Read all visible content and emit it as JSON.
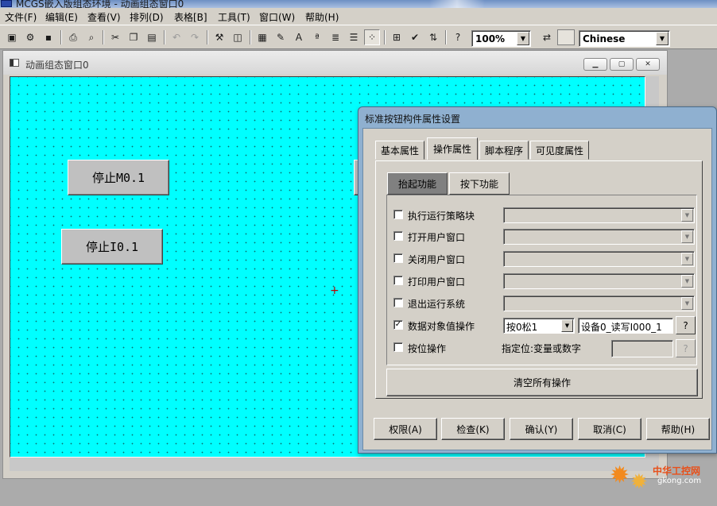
{
  "app": {
    "title": "MCGS嵌入版组态环境 - 动画组态窗口0"
  },
  "menubar": {
    "items": [
      "文件(F)",
      "编辑(E)",
      "查看(V)",
      "排列(D)",
      "表格[B]",
      "工具(T)",
      "窗口(W)",
      "帮助(H)"
    ]
  },
  "toolbar": {
    "zoom_value": "100%",
    "language_value": "Chinese",
    "icons": [
      "new-window-icon",
      "run-icon",
      "save-icon",
      "print-icon",
      "print-preview-icon",
      "cut-icon",
      "copy-icon",
      "paste-icon",
      "undo-icon",
      "redo-icon",
      "tools-icon",
      "layout-icon",
      "table-icon",
      "format-icon",
      "text-style-icon",
      "font-color-icon",
      "line-align-icon",
      "text-align-icon",
      "grid-icon",
      "properties-icon",
      "check-icon",
      "order-icon",
      "help-icon",
      "language-icon"
    ]
  },
  "child_window": {
    "title": "动画组态窗口0",
    "buttons": {
      "stop_m01": "停止M0.1",
      "stop_i01": "停止I0.1"
    }
  },
  "dialog": {
    "title": "标准按钮构件属性设置",
    "tabs": [
      "基本属性",
      "操作属性",
      "脚本程序",
      "可见度属性"
    ],
    "active_tab": "操作属性",
    "subtabs": [
      "抬起功能",
      "按下功能"
    ],
    "active_subtab": "抬起功能",
    "rows": [
      {
        "label": "执行运行策略块",
        "checked": false,
        "value": ""
      },
      {
        "label": "打开用户窗口",
        "checked": false,
        "value": ""
      },
      {
        "label": "关闭用户窗口",
        "checked": false,
        "value": ""
      },
      {
        "label": "打印用户窗口",
        "checked": false,
        "value": ""
      },
      {
        "label": "退出运行系统",
        "checked": false,
        "value": ""
      },
      {
        "label": "数据对象值操作",
        "checked": true,
        "value": "按0松1",
        "variable": "设备0_读写I000_1",
        "help": "?"
      },
      {
        "label": "按位操作",
        "checked": false,
        "hint": "指定位:变量或数字",
        "help": "?"
      }
    ],
    "clear_all": "清空所有操作",
    "footer_buttons": [
      "权限(A)",
      "检查(K)",
      "确认(Y)",
      "取消(C)",
      "帮助(H)"
    ]
  },
  "watermark": {
    "text_cn": "中华工控网",
    "text_en": "gkong.com"
  }
}
